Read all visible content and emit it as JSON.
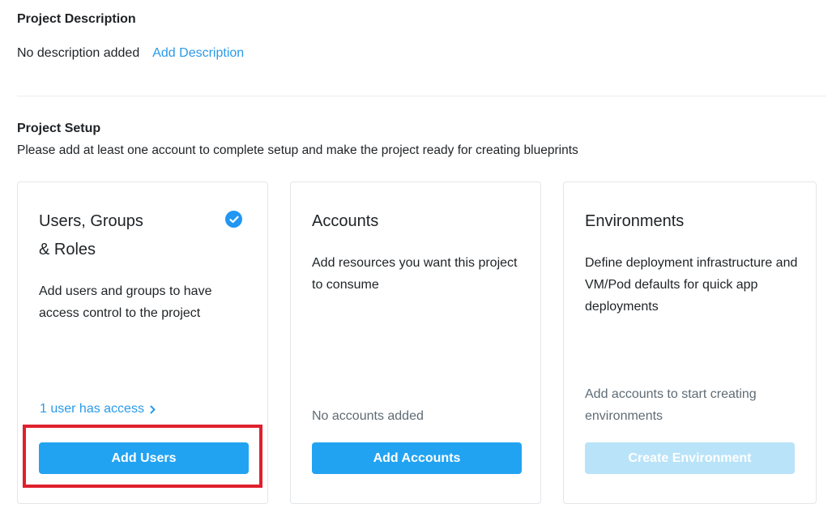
{
  "description": {
    "heading": "Project Description",
    "empty_text": "No description added",
    "add_link": "Add Description"
  },
  "setup": {
    "heading": "Project Setup",
    "subtitle": "Please add at least one account to complete setup and make the project ready for creating blueprints",
    "cards": [
      {
        "title_line1": "Users, Groups",
        "title_line2": "& Roles",
        "completed_icon": "check-circle-icon",
        "description": "Add users and groups to have access control to the project",
        "access_link": "1 user has access",
        "button": "Add Users"
      },
      {
        "title": "Accounts",
        "description": "Add resources you want this project to consume",
        "status": "No accounts added",
        "button": "Add Accounts"
      },
      {
        "title": "Environments",
        "description": "Define deployment infrastructure and VM/Pod defaults for quick app deployments",
        "status": "Add accounts to start creating environments",
        "button": "Create Environment",
        "button_disabled": true
      }
    ]
  },
  "colors": {
    "primary": "#22a3f2",
    "link": "#2a9ae8",
    "disabled_button": "#b9e3f8",
    "highlight": "#e0202d"
  }
}
